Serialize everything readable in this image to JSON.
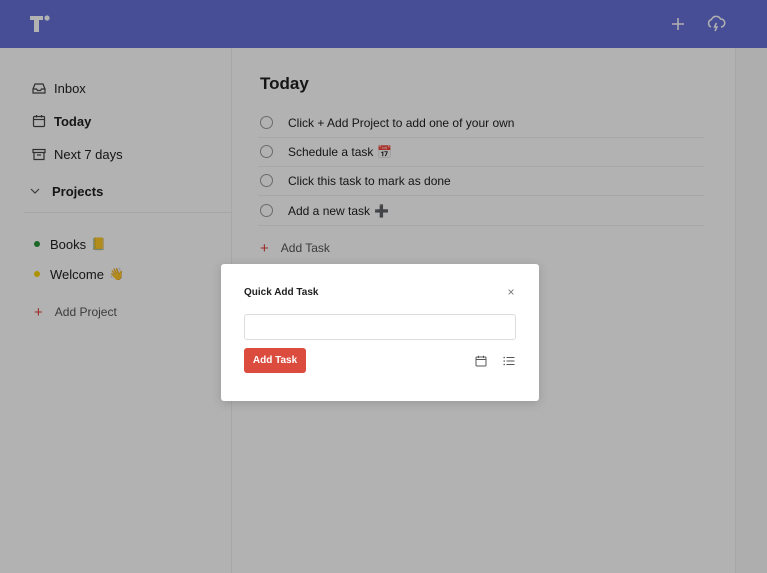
{
  "nav": {
    "inbox": "Inbox",
    "today": "Today",
    "next7": "Next 7 days",
    "projects": "Projects",
    "add_project": "Add Project"
  },
  "projects": [
    {
      "name": "Books",
      "emoji": "📒",
      "color": "#299438"
    },
    {
      "name": "Welcome",
      "emoji": "👋",
      "color": "#fad000"
    }
  ],
  "main": {
    "title": "Today",
    "tasks": [
      {
        "text": "Click + Add Project to add one of your own",
        "emoji": ""
      },
      {
        "text": "Schedule a task",
        "emoji": "📅"
      },
      {
        "text": "Click this task to mark as done",
        "emoji": ""
      },
      {
        "text": "Add a new task",
        "emoji": "➕"
      }
    ],
    "add_task": "Add Task"
  },
  "modal": {
    "title": "Quick Add Task",
    "close": "×",
    "input_value": "",
    "button": "Add Task"
  },
  "colors": {
    "topbar": "#6770d6",
    "accent_red": "#db4c3f"
  },
  "icons": {
    "logo": "logo-icon",
    "add": "plus-icon",
    "sync": "cloud-sync-icon",
    "inbox": "inbox-icon",
    "today": "calendar-icon",
    "next7": "upcoming-icon",
    "projects_toggle": "chevron-down-icon",
    "modal_date": "calendar-icon",
    "modal_project": "list-icon"
  }
}
